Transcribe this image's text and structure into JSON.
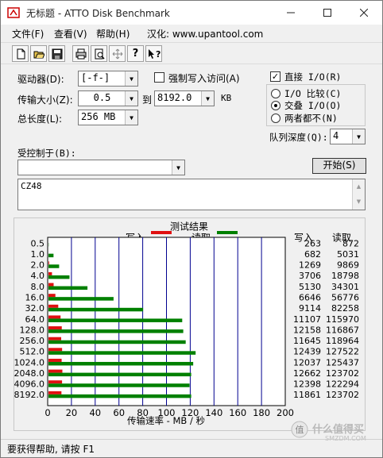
{
  "window": {
    "title": "无标题 - ATTO Disk Benchmark"
  },
  "menu": [
    "文件(F)",
    "查看(V)",
    "帮助(H)",
    "汉化: www.upantool.com"
  ],
  "toolbar": {
    "icons": [
      "new-icon",
      "open-icon",
      "save-icon",
      "print-icon",
      "print-preview-icon",
      "move-icon",
      "help-icon",
      "context-help-icon"
    ]
  },
  "form": {
    "drive_label": "驱动器(D):",
    "drive_value": "[-f-]",
    "force_write_label": "强制写入访问(A)",
    "transfer_label": "传输大小(Z):",
    "transfer_from": "0.5",
    "to_label": "到",
    "transfer_to": "8192.0",
    "kb_label": "KB",
    "total_label": "总长度(L):",
    "total_value": "256 MB",
    "direct_io_label": "直接 I/O(R)",
    "io_compare_label": "I/O 比较(C)",
    "overlap_io_label": "交叠 I/O(O)",
    "neither_label": "两者都不(N)",
    "queue_label": "队列深度(Q):",
    "queue_value": "4",
    "controlled_label": "受控制于(B):",
    "start_button": "开始(S)",
    "notes": "CZ48"
  },
  "results": {
    "title": "测试结果",
    "write_legend": "写入",
    "read_legend": "读取",
    "write_col": "写入",
    "read_col": "读取",
    "xlabel": "传输速率 - MB / 秒"
  },
  "colors": {
    "write": "#e01010",
    "read": "#008000",
    "grid": "#000090"
  },
  "chart_data": {
    "type": "bar",
    "title": "测试结果",
    "xlabel": "传输速率 - MB / 秒",
    "xlim": [
      0,
      200
    ],
    "xticks": [
      0,
      20,
      40,
      60,
      80,
      100,
      120,
      140,
      160,
      180,
      200
    ],
    "categories": [
      "0.5",
      "1.0",
      "2.0",
      "4.0",
      "8.0",
      "16.0",
      "32.0",
      "64.0",
      "128.0",
      "256.0",
      "512.0",
      "1024.0",
      "2048.0",
      "4096.0",
      "8192.0"
    ],
    "series": [
      {
        "name": "写入",
        "values": [
          263,
          682,
          1269,
          3706,
          5130,
          6646,
          9114,
          11107,
          12158,
          11645,
          12439,
          12037,
          12662,
          12398,
          11861
        ]
      },
      {
        "name": "读取",
        "values": [
          872,
          5031,
          9869,
          18798,
          34301,
          56776,
          82258,
          115970,
          116867,
          118964,
          127522,
          125437,
          123702,
          122294,
          123702
        ]
      }
    ]
  },
  "status": {
    "text": "要获得帮助, 请按 F1"
  },
  "watermark": {
    "text": "什么值得买",
    "sub": "SMZDM.COM"
  }
}
